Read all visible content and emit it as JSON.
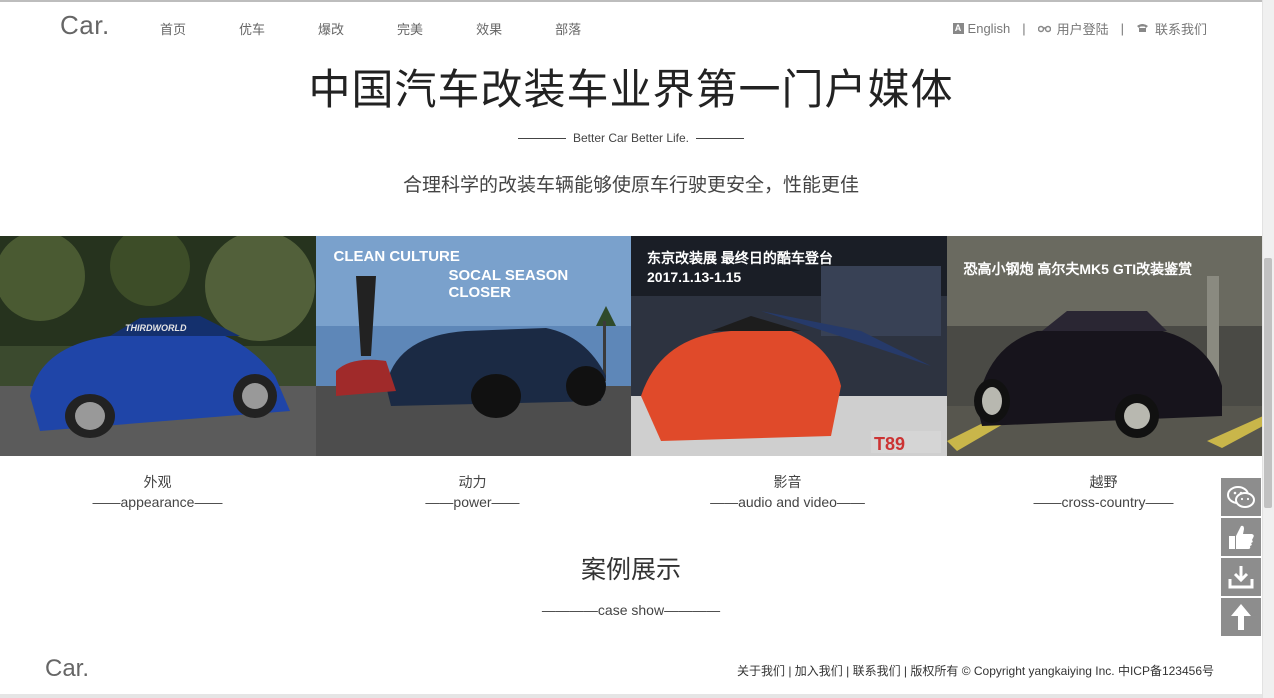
{
  "header": {
    "logo": "Car.",
    "nav": [
      "首页",
      "优车",
      "爆改",
      "完美",
      "效果",
      "部落"
    ],
    "english": "English",
    "login": "用户登陆",
    "contact": "联系我们",
    "sep": "|"
  },
  "hero": {
    "title": "中国汽车改装车业界第一门户媒体",
    "subtitle": "Better Car  Better Life.",
    "desc": "合理科学的改装车辆能够使原车行驶更安全，性能更佳"
  },
  "cards": [
    {
      "cn": "外观",
      "en": "——appearance——",
      "overlay": []
    },
    {
      "cn": "动力",
      "en": "——power——",
      "overlay": [
        "CLEAN CULTURE",
        "SOCAL SEASON CLOSER"
      ]
    },
    {
      "cn": "影音",
      "en": "——audio and video——",
      "overlay": [
        "东京改装展 最终日的酷车登台",
        "2017.1.13-1.15"
      ]
    },
    {
      "cn": "越野",
      "en": "——cross-country——",
      "overlay": [
        "恐高小钢炮 高尔夫MK5 GTI改装鉴赏"
      ]
    }
  ],
  "case": {
    "title": "案例展示",
    "subtitle": "————case show————"
  },
  "footer": {
    "logo": "Car.",
    "links": "关于我们 | 加入我们 | 联系我们 | 版权所有 © Copyright yangkaiying Inc. 中ICP备123456号"
  },
  "side_tools": [
    "wechat-icon",
    "thumbs-up-icon",
    "download-icon",
    "arrow-up-icon"
  ],
  "colors": {
    "tool_bg": "#8d8d8d",
    "text": "#333333"
  }
}
